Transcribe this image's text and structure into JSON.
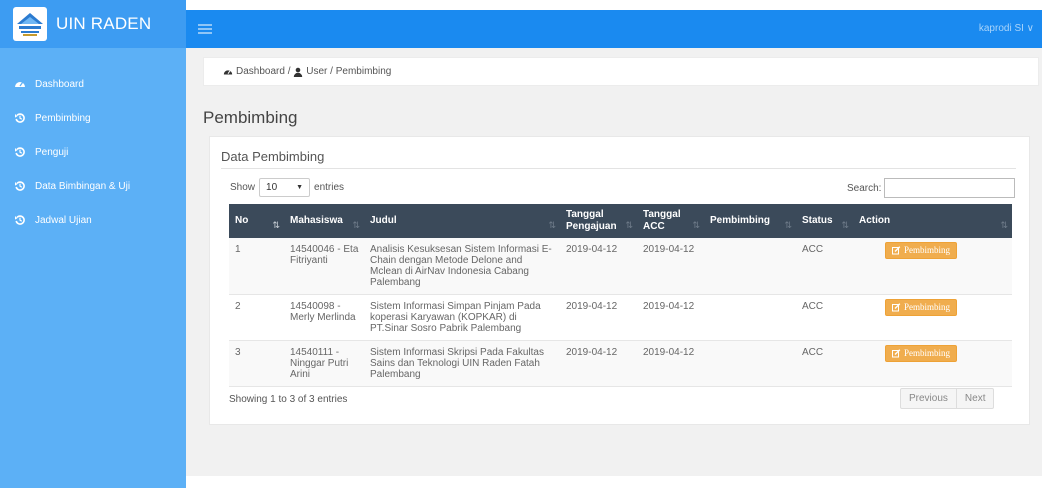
{
  "brand": {
    "name": "UIN RADEN"
  },
  "sidebar": {
    "items": [
      {
        "label": "Dashboard",
        "icon": "dashboard-icon"
      },
      {
        "label": "Pembimbing",
        "icon": "history-icon"
      },
      {
        "label": "Penguji",
        "icon": "history-icon"
      },
      {
        "label": "Data Bimbingan & Uji",
        "icon": "history-icon"
      },
      {
        "label": "Jadwal Ujian",
        "icon": "history-icon"
      }
    ]
  },
  "topbar": {
    "user_label": "kaprodi SI ∨"
  },
  "breadcrumb": {
    "items": [
      "Dashboard",
      "User",
      "Pembimbing"
    ],
    "separator": " / "
  },
  "page": {
    "title": "Pembimbing"
  },
  "card": {
    "title": "Data Pembimbing"
  },
  "table_controls": {
    "show_label": "Show",
    "entries_value": "10",
    "entries_label": "entries",
    "search_label": "Search:",
    "search_value": ""
  },
  "table": {
    "headers": {
      "no": "No",
      "mahasiswa": "Mahasiswa",
      "judul": "Judul",
      "tgl_pengajuan_1": "Tanggal",
      "tgl_pengajuan_2": "Pengajuan",
      "tgl_acc_1": "Tanggal",
      "tgl_acc_2": "ACC",
      "pembimbing": "Pembimbing",
      "status": "Status",
      "action": "Action"
    },
    "rows": [
      {
        "no": "1",
        "mahasiswa": "14540046 - Eta Fitriyanti",
        "judul": "Analisis Kesuksesan Sistem Informasi E-Chain dengan Metode Delone and Mclean di AirNav Indonesia Cabang Palembang",
        "tgl_pengajuan": "2019-04-12",
        "tgl_acc": "2019-04-12",
        "pembimbing": "",
        "status": "ACC",
        "action": "Pembimbing"
      },
      {
        "no": "2",
        "mahasiswa": "14540098 - Merly Merlinda",
        "judul": "Sistem Informasi Simpan Pinjam Pada koperasi Karyawan (KOPKAR) di PT.Sinar Sosro Pabrik Palembang",
        "tgl_pengajuan": "2019-04-12",
        "tgl_acc": "2019-04-12",
        "pembimbing": "",
        "status": "ACC",
        "action": "Pembimbing"
      },
      {
        "no": "3",
        "mahasiswa": "14540111 - Ninggar Putri Arini",
        "judul": "Sistem Informasi Skripsi Pada Fakultas Sains dan Teknologi UIN Raden Fatah Palembang",
        "tgl_pengajuan": "2019-04-12",
        "tgl_acc": "2019-04-12",
        "pembimbing": "",
        "status": "ACC",
        "action": "Pembimbing"
      }
    ]
  },
  "footer": {
    "info": "Showing 1 to 3 of 3 entries",
    "prev_label": "Previous",
    "next_label": "Next"
  },
  "colors": {
    "sidebar": "#5cb0f6",
    "topbar": "#1a8af0",
    "table_header": "#3b4a5a",
    "warning_button": "#f0ad4e"
  }
}
